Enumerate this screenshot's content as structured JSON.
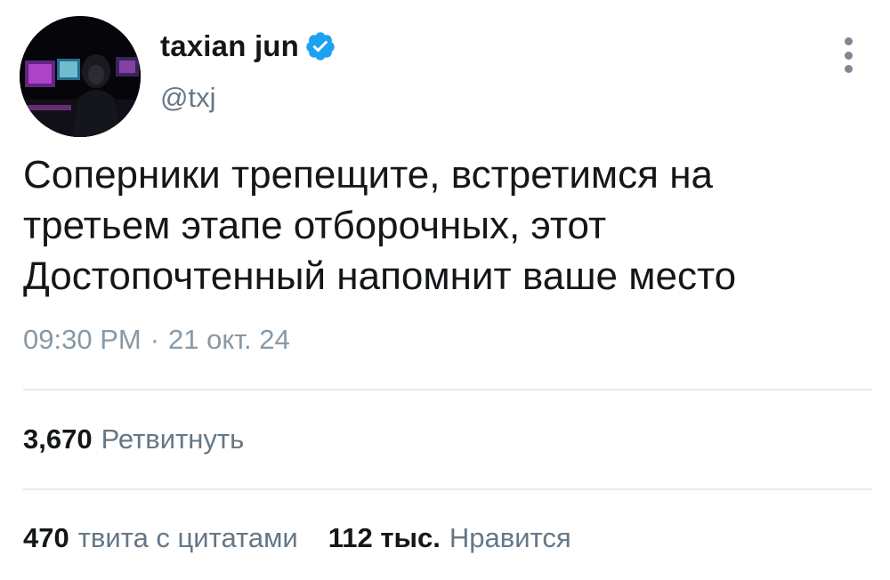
{
  "user": {
    "display_name": "taxian jun",
    "handle": "@txj",
    "verified": true,
    "verified_color": "#1da1f2"
  },
  "tweet": {
    "lines": [
      "Соперники трепещите, встретимся на",
      "третьем этапе отборочных, этот",
      "Достопочтенный напомнит ваше место"
    ],
    "time": "09:30 PM",
    "separator": "·",
    "date": "21 окт. 24"
  },
  "stats": {
    "retweets": {
      "count": "3,670",
      "label": "Ретвитнуть"
    },
    "quotes": {
      "count": "470",
      "label": "твита с цитатами"
    },
    "likes": {
      "count": "112 тыс.",
      "label": "Нравится"
    }
  },
  "icons": {
    "more": "more-vertical-icon",
    "verified": "verified-badge-icon"
  },
  "colors": {
    "text": "#14171a",
    "secondary": "#657786",
    "timestamp": "#8899a6",
    "divider": "#e6ecf0"
  }
}
